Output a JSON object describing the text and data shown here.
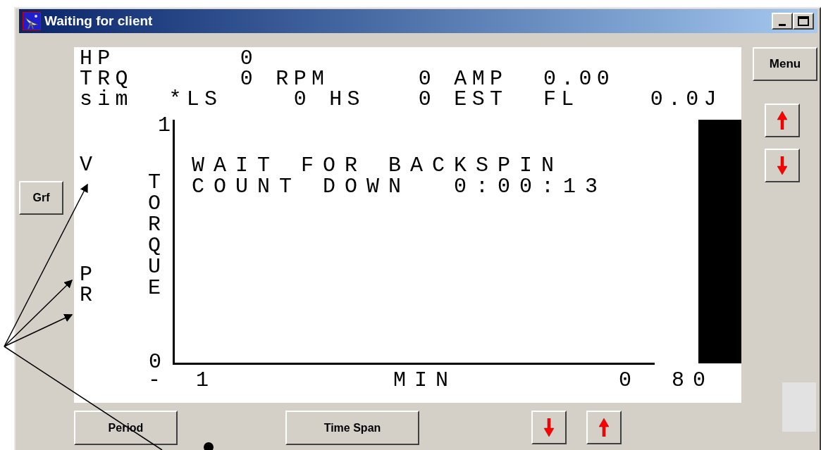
{
  "window": {
    "title": "Waiting for client"
  },
  "readout_lines": [
    "HP       0",
    "TRQ      0 RPM     0 AMP  0.00",
    "sim  *LS    0 HS   0 EST  FL    0.0J"
  ],
  "trace_labels": [
    "V",
    "P",
    "R"
  ],
  "graph": {
    "y_max": "1",
    "y_min": "0",
    "y_title": "TORQUE",
    "message_lines": [
      "WAIT FOR BACKSPIN",
      "COUNT DOWN  0:00:13"
    ],
    "x_labels": [
      "-",
      "1",
      "MIN",
      "0",
      "80"
    ]
  },
  "side_buttons": {
    "left": "Grf",
    "right": "Menu"
  },
  "bottom_buttons": [
    "Period",
    "Time Span"
  ]
}
